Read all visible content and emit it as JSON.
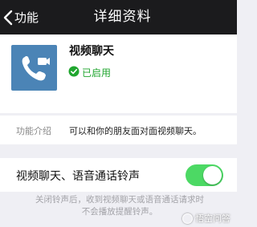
{
  "navbar": {
    "back_label": "功能",
    "title": "详细资料"
  },
  "app": {
    "name": "视频聊天",
    "status": "已启用",
    "icon": "video-call-icon",
    "accent_color": "#4b84b6",
    "status_color": "#20a62f"
  },
  "intro": {
    "label": "功能介绍",
    "value": "可以和你的朋友面对面视频聊天。"
  },
  "ringtone": {
    "label": "视频聊天、语音通话铃声",
    "toggle_on": true,
    "toggle_color": "#4cd964"
  },
  "footnote": {
    "line1": "关闭铃声后，收到视频聊天或语音通话请求时",
    "line2": "不会播放提醒铃声。"
  },
  "watermark": {
    "text": "悟空问答"
  }
}
